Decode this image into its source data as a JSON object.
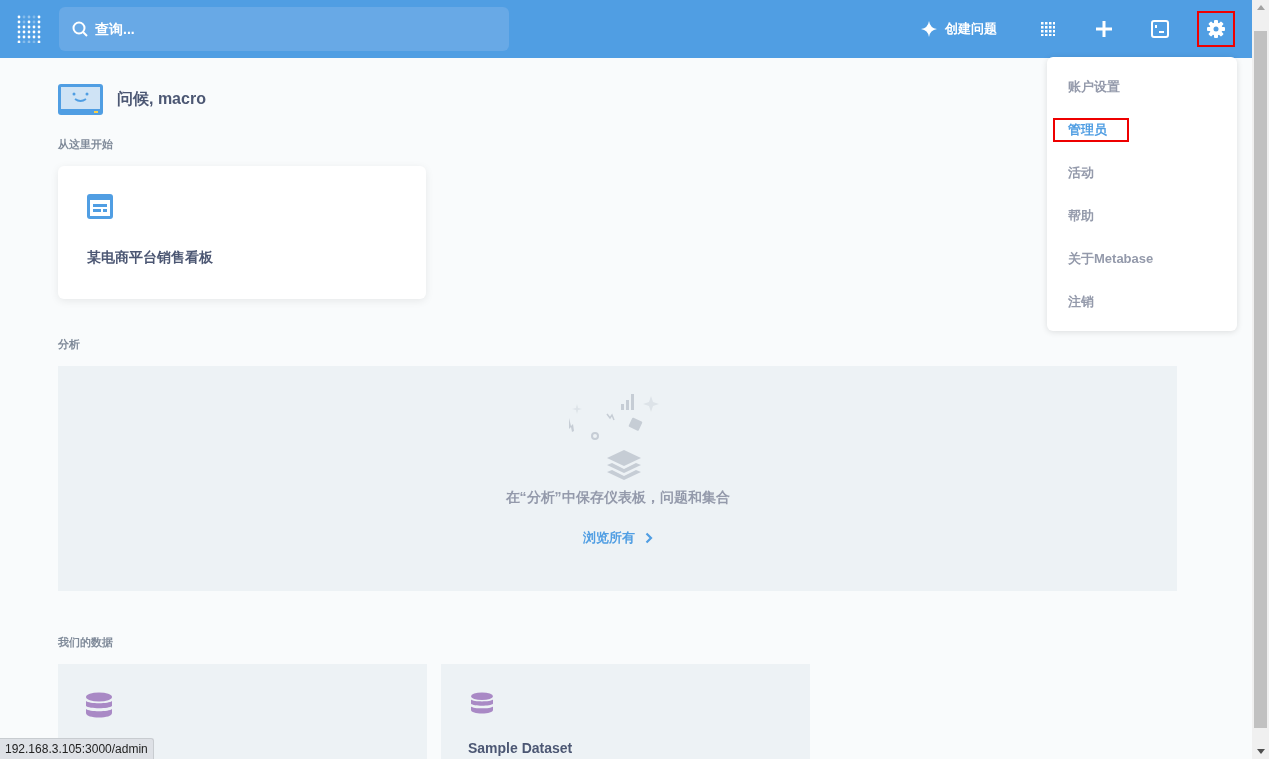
{
  "header": {
    "search": {
      "placeholder": "查询..."
    },
    "new_question": "创建问题",
    "settings_highlighted": true
  },
  "settings_menu": [
    {
      "label": "账户设置",
      "selected": false,
      "highlighted": false
    },
    {
      "label": "管理员",
      "selected": true,
      "highlighted": true
    },
    {
      "label": "活动",
      "selected": false,
      "highlighted": false
    },
    {
      "label": "帮助",
      "selected": false,
      "highlighted": false
    },
    {
      "label": "关于Metabase",
      "selected": false,
      "highlighted": false
    },
    {
      "label": "注销",
      "selected": false,
      "highlighted": false
    }
  ],
  "greeting": "问候, macro",
  "start_here": {
    "heading": "从这里开始",
    "cards": [
      {
        "title": "某电商平台销售看板"
      }
    ]
  },
  "analytics": {
    "heading": "分析",
    "empty_message": "在“分析”中保存仪表板，问题和集合",
    "browse_link": "浏览所有"
  },
  "our_data": {
    "heading": "我们的数据",
    "databases": [
      {
        "kind": "database"
      },
      {
        "kind": "database",
        "title": "Sample Dataset"
      }
    ]
  },
  "status_bar": {
    "url": "192.168.3.105:3000/admin"
  }
}
